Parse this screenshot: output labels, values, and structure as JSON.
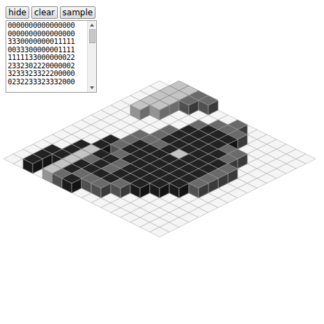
{
  "buttons": [
    {
      "label": "hide"
    },
    {
      "label": "clear"
    },
    {
      "label": "sample"
    }
  ],
  "editor": {
    "lines": [
      "0000000000000000",
      "0000000000000000",
      "3330000000011111",
      "0033300000001111",
      "1111133000000022",
      "2332302220000002",
      "3233323322200000",
      "0232233323332000"
    ]
  },
  "scene": {
    "colors": {
      "1": "#c4c4c4",
      "2": "#6a6a6a",
      "3": "#222222"
    },
    "cells": [
      [
        0,
        0,
        0,
        0,
        0,
        0,
        0,
        0,
        0,
        0,
        0,
        0,
        0,
        0,
        0,
        0
      ],
      [
        0,
        0,
        0,
        0,
        0,
        0,
        0,
        0,
        0,
        0,
        0,
        0,
        0,
        0,
        0,
        0
      ],
      [
        3,
        3,
        3,
        0,
        0,
        0,
        0,
        0,
        0,
        0,
        0,
        1,
        1,
        1,
        1,
        1
      ],
      [
        0,
        0,
        3,
        3,
        3,
        0,
        0,
        0,
        0,
        0,
        0,
        0,
        1,
        1,
        1,
        1
      ],
      [
        1,
        1,
        1,
        1,
        1,
        3,
        3,
        0,
        0,
        0,
        0,
        0,
        0,
        0,
        2,
        2
      ],
      [
        2,
        3,
        3,
        2,
        3,
        0,
        2,
        2,
        2,
        0,
        0,
        0,
        0,
        0,
        0,
        2
      ],
      [
        3,
        2,
        3,
        3,
        3,
        2,
        3,
        3,
        2,
        2,
        2,
        0,
        0,
        0,
        0,
        0
      ],
      [
        0,
        2,
        3,
        2,
        2,
        3,
        3,
        3,
        2,
        3,
        3,
        3,
        2,
        0,
        0,
        0
      ],
      [
        0,
        2,
        3,
        3,
        3,
        3,
        3,
        3,
        3,
        3,
        3,
        3,
        3,
        2,
        0,
        0
      ],
      [
        0,
        0,
        2,
        3,
        3,
        3,
        3,
        3,
        1,
        3,
        3,
        3,
        3,
        2,
        2,
        0
      ],
      [
        0,
        0,
        0,
        3,
        3,
        3,
        3,
        3,
        3,
        3,
        3,
        3,
        3,
        2,
        0,
        0
      ],
      [
        0,
        0,
        0,
        0,
        3,
        3,
        3,
        3,
        3,
        3,
        3,
        2,
        0,
        0,
        0,
        0
      ],
      [
        0,
        0,
        0,
        0,
        0,
        3,
        3,
        3,
        3,
        3,
        2,
        2,
        0,
        0,
        0,
        0
      ],
      [
        0,
        0,
        0,
        0,
        0,
        0,
        2,
        2,
        2,
        2,
        0,
        0,
        0,
        0,
        0,
        0
      ],
      [
        0,
        0,
        0,
        0,
        0,
        0,
        0,
        0,
        0,
        0,
        0,
        0,
        0,
        0,
        0,
        0
      ],
      [
        0,
        0,
        0,
        0,
        0,
        0,
        0,
        0,
        0,
        0,
        0,
        0,
        0,
        0,
        0,
        0
      ]
    ]
  }
}
